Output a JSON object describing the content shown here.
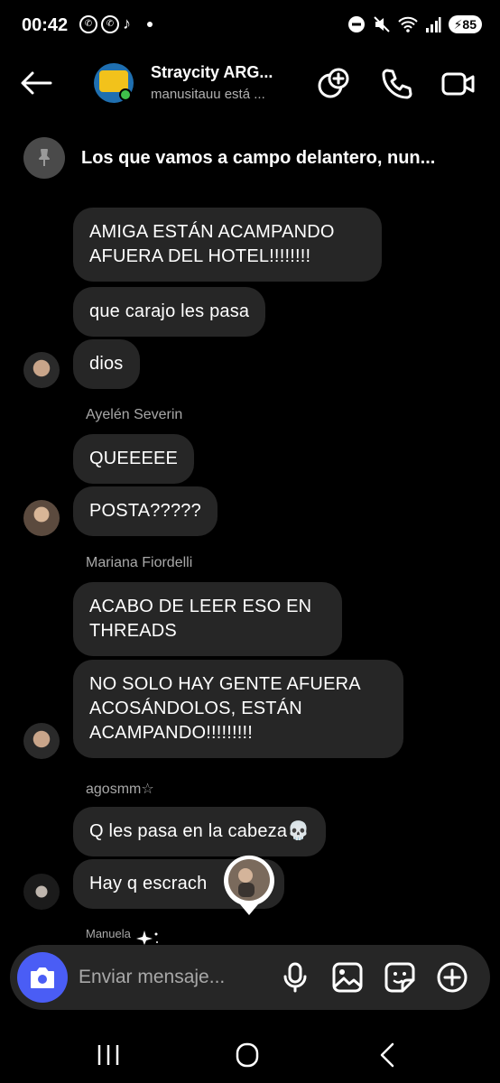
{
  "status_bar": {
    "time": "00:42",
    "battery": "85",
    "app_icons": [
      "whatsapp-icon",
      "whatsapp-icon",
      "tiktok-icon"
    ]
  },
  "header": {
    "title": "Straycity ARG...",
    "subtitle": "manusitauu está ..."
  },
  "pinned": {
    "text": "Los que vamos a campo delantero, nun..."
  },
  "messages": [
    {
      "id": "m1",
      "text": "AMIGA ESTÁN ACAMPANDO AFUERA DEL HOTEL!!!!!!!!"
    },
    {
      "id": "m2",
      "text": "que carajo les pasa"
    },
    {
      "id": "m3",
      "text": "dios"
    },
    {
      "id": "m4",
      "text": "QUEEEEE"
    },
    {
      "id": "m5",
      "text": "POSTA?????"
    },
    {
      "id": "m6",
      "text": "ACABO DE LEER ESO EN THREADS"
    },
    {
      "id": "m7",
      "text": "NO SOLO HAY GENTE AFUERA ACOSÁNDOLOS, ESTÁN ACAMPANDO!!!!!!!!!"
    },
    {
      "id": "m8",
      "text": "Q les pasa en la cabeza💀"
    },
    {
      "id": "m9",
      "text": "Hay q escrach    odos"
    }
  ],
  "senders": {
    "s1": "Ayelén Severin",
    "s2": "Mariana Fiordelli",
    "s3": "agosmm☆",
    "s4": "Manuela"
  },
  "composer": {
    "placeholder": "Enviar mensaje..."
  },
  "colors": {
    "background": "#000000",
    "bubble": "#262626",
    "camera_button": "#4a5df5",
    "online_dot": "#3fbf4a"
  }
}
